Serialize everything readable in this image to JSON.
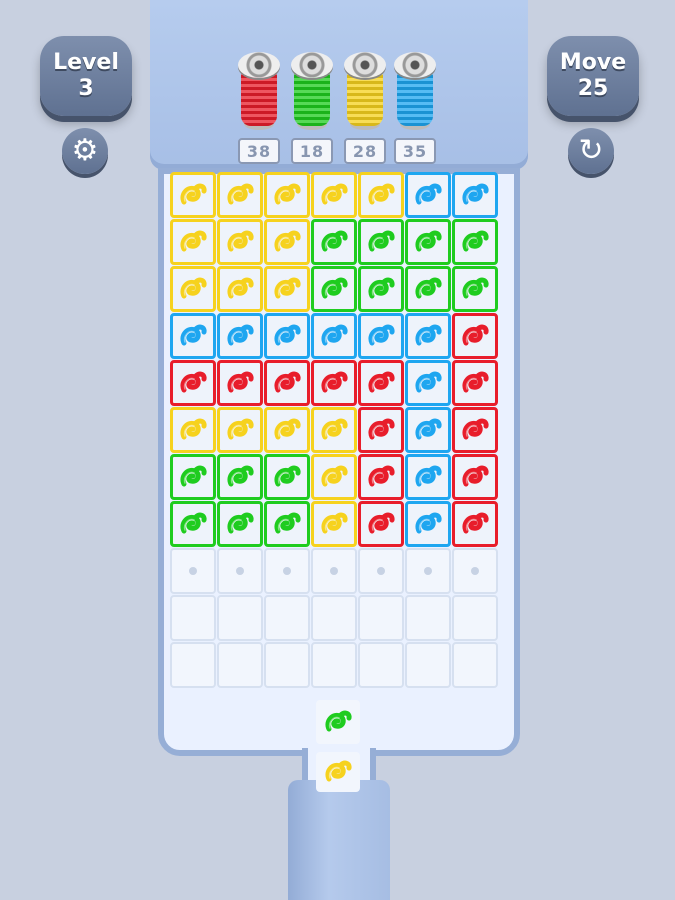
{
  "hud": {
    "level_label": "Level",
    "level_value": "3",
    "move_label": "Move",
    "move_value": "25"
  },
  "icons": {
    "settings": "gear-icon",
    "restart": "restart-icon"
  },
  "colors": {
    "yellow": "#f6d21e",
    "green": "#1fcc1f",
    "blue": "#1ea6f0",
    "red": "#e81d2b"
  },
  "spools": [
    {
      "color": "red",
      "count": "38"
    },
    {
      "color": "green",
      "count": "18"
    },
    {
      "color": "yellow",
      "count": "28"
    },
    {
      "color": "blue",
      "count": "35"
    }
  ],
  "grid": [
    [
      "yellow",
      "yellow",
      "yellow",
      "yellow",
      "yellow",
      "blue",
      "blue"
    ],
    [
      "yellow",
      "yellow",
      "yellow",
      "green",
      "green",
      "green",
      "green"
    ],
    [
      "yellow",
      "yellow",
      "yellow",
      "green",
      "green",
      "green",
      "green"
    ],
    [
      "blue",
      "blue",
      "blue",
      "blue",
      "blue",
      "blue",
      "red"
    ],
    [
      "red",
      "red",
      "red",
      "red",
      "red",
      "blue",
      "red"
    ],
    [
      "yellow",
      "yellow",
      "yellow",
      "yellow",
      "red",
      "blue",
      "red"
    ],
    [
      "green",
      "green",
      "green",
      "yellow",
      "red",
      "blue",
      "red"
    ],
    [
      "green",
      "green",
      "green",
      "yellow",
      "red",
      "blue",
      "red"
    ],
    [
      "dot",
      "dot",
      "dot",
      "dot",
      "dot",
      "dot",
      "dot"
    ],
    [
      "empty",
      "empty",
      "empty",
      "empty",
      "empty",
      "empty",
      "empty"
    ],
    [
      "empty",
      "empty",
      "empty",
      "empty",
      "empty",
      "empty",
      "empty"
    ]
  ],
  "queue": [
    "green",
    "yellow"
  ]
}
